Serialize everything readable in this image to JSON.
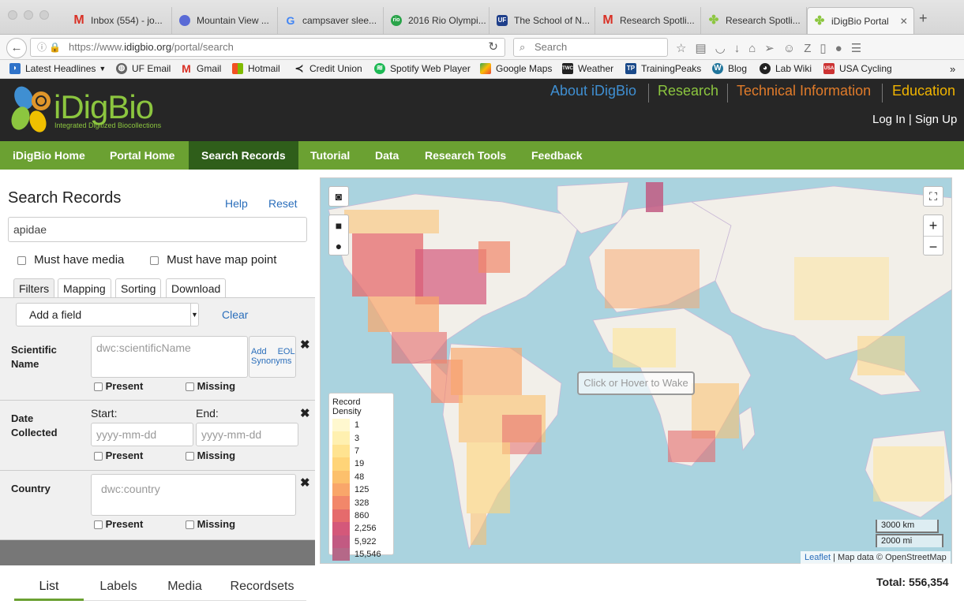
{
  "browser": {
    "tabs": [
      {
        "label": "Inbox (554) - jo...",
        "icon": "gmail-icon"
      },
      {
        "label": "Mountain View ...",
        "icon": "circle-icon"
      },
      {
        "label": "campsaver slee...",
        "icon": "google-icon"
      },
      {
        "label": "2016 Rio Olympi...",
        "icon": "rio-icon"
      },
      {
        "label": "The School of N...",
        "icon": "uf-icon"
      },
      {
        "label": "Research Spotli...",
        "icon": "gmail-icon"
      },
      {
        "label": "Research Spotli...",
        "icon": "idigbio-icon"
      },
      {
        "label": "iDigBio Portal",
        "icon": "idigbio-icon"
      }
    ],
    "url_prefix": "https://www.",
    "url_domain": "idigbio.org",
    "url_path": "/portal/search",
    "search_placeholder": "Search",
    "bookmarks": [
      "Latest Headlines",
      "UF Email",
      "Gmail",
      "Hotmail",
      "Credit Union",
      "Spotify Web Player",
      "Google Maps",
      "Weather",
      "TrainingPeaks",
      "Blog",
      "Lab Wiki",
      "USA Cycling"
    ]
  },
  "site": {
    "logo_name": "iDigBio",
    "logo_sub": "Integrated Digitized Biocollections",
    "topnav": [
      "About iDigBio",
      "Research",
      "Technical Information",
      "Education"
    ],
    "topnav_colors": [
      "#3f8fd2",
      "#8cc63f",
      "#e07b2a",
      "#f0b400"
    ],
    "login": "Log In",
    "signup": "Sign Up",
    "login_sep": "|",
    "mainnav": [
      "iDigBio Home",
      "Portal Home",
      "Search Records",
      "Tutorial",
      "Data",
      "Research Tools",
      "Feedback"
    ]
  },
  "panel": {
    "title": "Search Records",
    "help": "Help",
    "reset": "Reset",
    "search_value": "apidae",
    "must_media": "Must have media",
    "must_map": "Must have map point",
    "tabs": [
      "Filters",
      "Mapping",
      "Sorting",
      "Download"
    ],
    "add_field": "Add a field",
    "clear": "Clear",
    "filters": {
      "scientific_label_1": "Scientific",
      "scientific_label_2": "Name",
      "scientific_placeholder": "dwc:scientificName",
      "add_eol_1": "Add",
      "add_eol_2": "EOL",
      "add_eol_3": "Synonyms",
      "date_label_1": "Date",
      "date_label_2": "Collected",
      "start": "Start:",
      "end": "End:",
      "date_placeholder": "yyyy-mm-dd",
      "country_label": "Country",
      "country_placeholder": "dwc:country",
      "present": "Present",
      "missing": "Missing"
    }
  },
  "map": {
    "wake": "Click or Hover to Wake",
    "legend_title": "Record Density",
    "legend": [
      "1",
      "3",
      "7",
      "19",
      "48",
      "125",
      "328",
      "860",
      "2,256",
      "5,922",
      "15,546"
    ],
    "legend_colors": [
      "#fff8cf",
      "#fff0b0",
      "#ffe390",
      "#ffd478",
      "#fcc06c",
      "#f9a66a",
      "#f2876a",
      "#e56b6c",
      "#d4587a",
      "#c25a82",
      "#b56888"
    ],
    "scale_km": "3000 km",
    "scale_mi": "2000 mi",
    "attrib_link": "Leaflet",
    "attrib_text": " | Map data © OpenStreetMap"
  },
  "results": {
    "tabs": [
      "List",
      "Labels",
      "Media",
      "Recordsets"
    ],
    "total": "Total: 556,354"
  }
}
